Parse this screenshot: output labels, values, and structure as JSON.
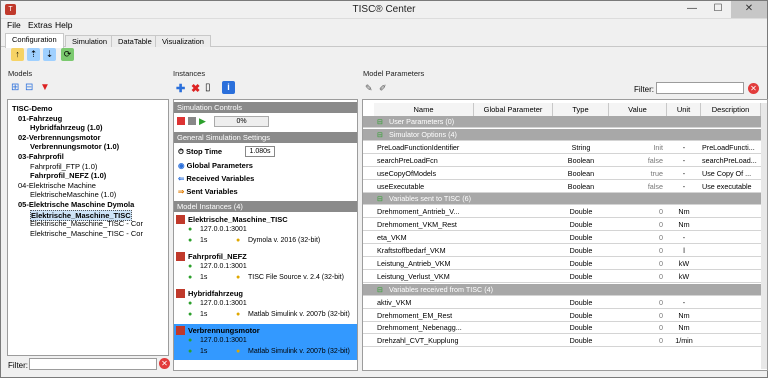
{
  "window": {
    "title": "TISC® Center",
    "min": "—",
    "max": "☐",
    "close": "✕"
  },
  "menu": [
    "File",
    "Extras",
    "Help"
  ],
  "tabs": [
    "Configuration",
    "Simulation",
    "DataTable",
    "Visualization"
  ],
  "models": {
    "header": "Models",
    "filter_label": "Filter:",
    "tree": [
      {
        "label": "TISC-Demo",
        "bold": true,
        "indent": 0
      },
      {
        "label": "01-Fahrzeug",
        "bold": true,
        "indent": 1
      },
      {
        "label": "Hybridfahrzeug (1.0)",
        "bold": true,
        "indent": 3
      },
      {
        "label": "02-Verbrennungsmotor",
        "bold": true,
        "indent": 1
      },
      {
        "label": "Verbrennungsmotor (1.0)",
        "bold": true,
        "indent": 3
      },
      {
        "label": "03-Fahrprofil",
        "bold": true,
        "indent": 1
      },
      {
        "label": "Fahrprofil_FTP (1.0)",
        "bold": false,
        "indent": 3
      },
      {
        "label": "Fahrprofil_NEFZ (1.0)",
        "bold": true,
        "indent": 3
      },
      {
        "label": "04-Elektrische Machine",
        "bold": false,
        "indent": 1
      },
      {
        "label": "ElektrischeMaschine (1.0)",
        "bold": false,
        "indent": 3
      },
      {
        "label": "05-Elektrische Maschine Dymola",
        "bold": true,
        "indent": 1
      },
      {
        "label": "Elektrische_Maschine_TISC",
        "bold": true,
        "indent": 3,
        "selected": true
      },
      {
        "label": "Elektrische_Maschine_TISC - Cor",
        "bold": false,
        "indent": 3
      },
      {
        "label": "Elektrische_Maschine_TISC - Cor",
        "bold": false,
        "indent": 3
      }
    ]
  },
  "instances": {
    "header": "Instances",
    "sim_controls": "Simulation Controls",
    "progress": "0%",
    "general_settings": "General Simulation Settings",
    "stop_time_label": "Stop Time",
    "stop_time_value": "1.080s",
    "global_params": "Global Parameters",
    "received_vars": "Received Variables",
    "sent_vars": "Sent Variables",
    "model_instances": "Model Instances (4)",
    "list": [
      {
        "name": "Elektrische_Maschine_TISC",
        "addr": "127.0.0.1:3001",
        "step": "1s",
        "tool": "Dymola v. 2016 (32-bit)"
      },
      {
        "name": "Fahrprofil_NEFZ",
        "addr": "127.0.0.1:3001",
        "step": "1s",
        "tool": "TISC File Source v. 2.4 (32-bit)"
      },
      {
        "name": "Hybridfahrzeug",
        "addr": "127.0.0.1:3001",
        "step": "1s",
        "tool": "Matlab Simulink v. 2007b (32-bit)"
      },
      {
        "name": "Verbrennungsmotor",
        "addr": "127.0.0.1:3001",
        "step": "1s",
        "tool": "Matlab Simulink v. 2007b (32-bit)",
        "selected": true
      }
    ]
  },
  "params": {
    "header": "Model Parameters",
    "filter_label": "Filter:",
    "columns": [
      "Name",
      "Global Parameter",
      "Type",
      "Value",
      "Unit",
      "Description"
    ],
    "rows": [
      {
        "group": "User Parameters (0)"
      },
      {
        "group": "Simulator Options (4)"
      },
      {
        "n": "PreLoadFunctionIdentifier",
        "t": "String",
        "v": "Init",
        "u": "-",
        "d": "PreLoadFuncti..."
      },
      {
        "n": "searchPreLoadFcn",
        "t": "Boolean",
        "v": "false",
        "u": "-",
        "d": "searchPreLoad..."
      },
      {
        "n": "useCopyOfModels",
        "t": "Boolean",
        "v": "true",
        "u": "-",
        "d": "Use Copy Of ..."
      },
      {
        "n": "useExecutable",
        "t": "Boolean",
        "v": "false",
        "u": "-",
        "d": "Use executable"
      },
      {
        "group": "Variables sent to TISC (6)"
      },
      {
        "n": "Drehmoment_Antrieb_V...",
        "t": "Double",
        "v": "0",
        "u": "Nm",
        "d": ""
      },
      {
        "n": "Drehmoment_VKM_Rest",
        "t": "Double",
        "v": "0",
        "u": "Nm",
        "d": ""
      },
      {
        "n": "eta_VKM",
        "t": "Double",
        "v": "0",
        "u": "-",
        "d": ""
      },
      {
        "n": "Kraftstoffbedarf_VKM",
        "t": "Double",
        "v": "0",
        "u": "l",
        "d": ""
      },
      {
        "n": "Leistung_Antrieb_VKM",
        "t": "Double",
        "v": "0",
        "u": "kW",
        "d": ""
      },
      {
        "n": "Leistung_Verlust_VKM",
        "t": "Double",
        "v": "0",
        "u": "kW",
        "d": ""
      },
      {
        "group": "Variables received from TISC (4)"
      },
      {
        "n": "aktiv_VKM",
        "t": "Double",
        "v": "0",
        "u": "-",
        "d": ""
      },
      {
        "n": "Drehmoment_EM_Rest",
        "t": "Double",
        "v": "0",
        "u": "Nm",
        "d": ""
      },
      {
        "n": "Drehmoment_Nebenagg...",
        "t": "Double",
        "v": "0",
        "u": "Nm",
        "d": ""
      },
      {
        "n": "Drehzahl_CVT_Kupplung",
        "t": "Double",
        "v": "0",
        "u": "1/min",
        "d": ""
      }
    ]
  }
}
